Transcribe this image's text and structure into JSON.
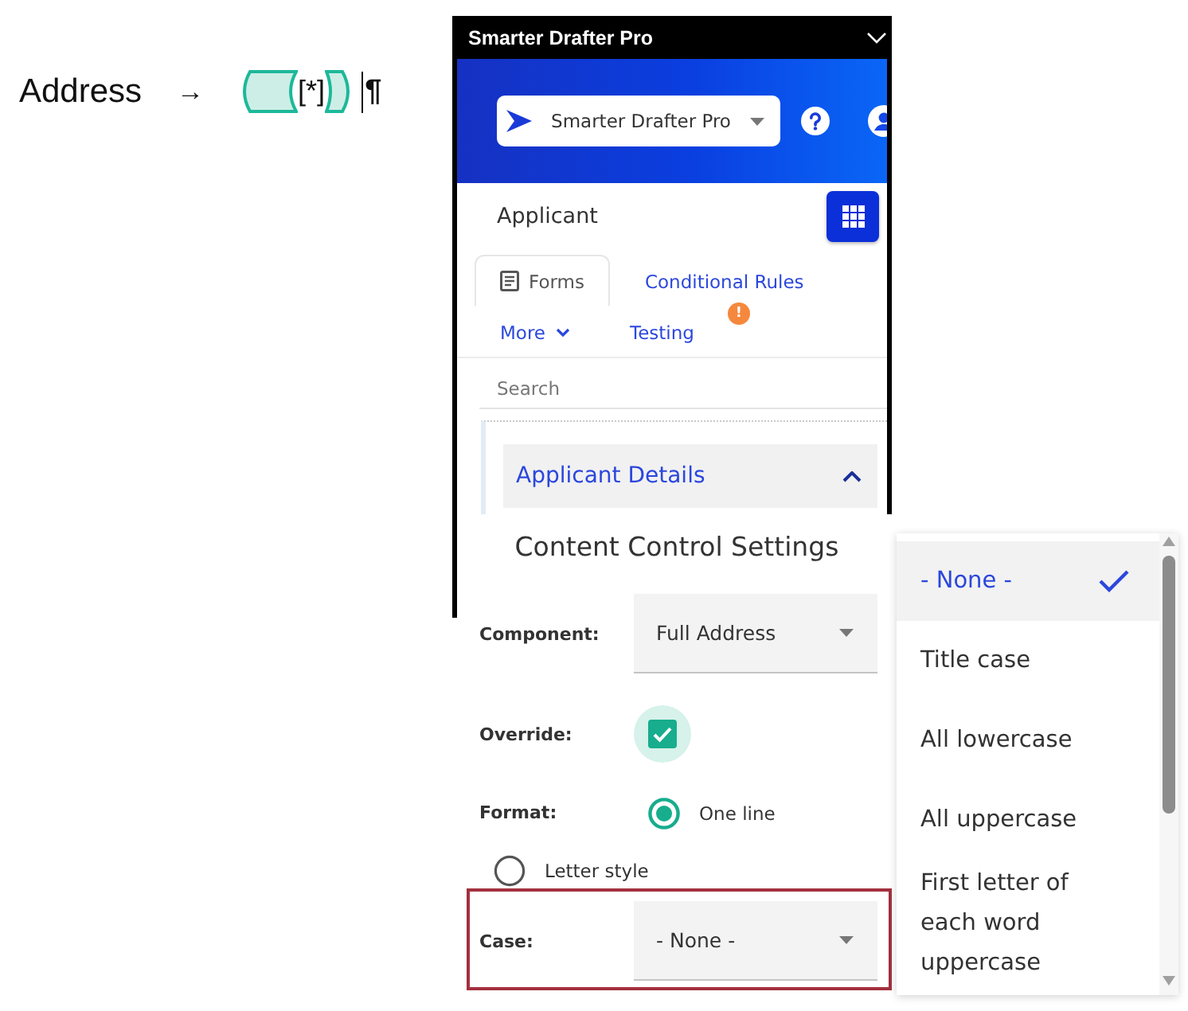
{
  "document": {
    "field_name": "Address",
    "arrow": "→",
    "content_control": "[*]",
    "pilcrow": "¶"
  },
  "addin_window": {
    "title": "Smarter Drafter Pro",
    "app_selector": "Smarter Drafter Pro",
    "section_title": "Applicant",
    "tabs": [
      {
        "label": "Forms",
        "selected": true,
        "kind": "forms"
      },
      {
        "label": "Conditional Rules",
        "selected": false,
        "kind": "plain"
      },
      {
        "label": "More",
        "selected": false,
        "kind": "menu"
      },
      {
        "label": "Testing",
        "selected": false,
        "kind": "plain",
        "badge": "!"
      }
    ],
    "search": {
      "placeholder": "Search"
    },
    "group": {
      "title": "Applicant Details",
      "expanded": true
    }
  },
  "settings_dialog": {
    "title": "Content Control Settings",
    "component": {
      "label": "Component:",
      "value": "Full Address"
    },
    "override": {
      "label": "Override:",
      "checked": true
    },
    "format": {
      "label": "Format:",
      "options": [
        {
          "label": "One line",
          "selected": true
        },
        {
          "label": "Letter style",
          "selected": false
        }
      ]
    },
    "case": {
      "label": "Case:",
      "value": "- None -",
      "highlighted": true
    }
  },
  "case_menu": {
    "options": [
      {
        "label": "- None -",
        "selected": true
      },
      {
        "label": "Title case",
        "selected": false
      },
      {
        "label": "All lowercase",
        "selected": false
      },
      {
        "label": "All uppercase",
        "selected": false
      },
      {
        "label": "First letter of each word uppercase",
        "selected": false
      }
    ]
  }
}
